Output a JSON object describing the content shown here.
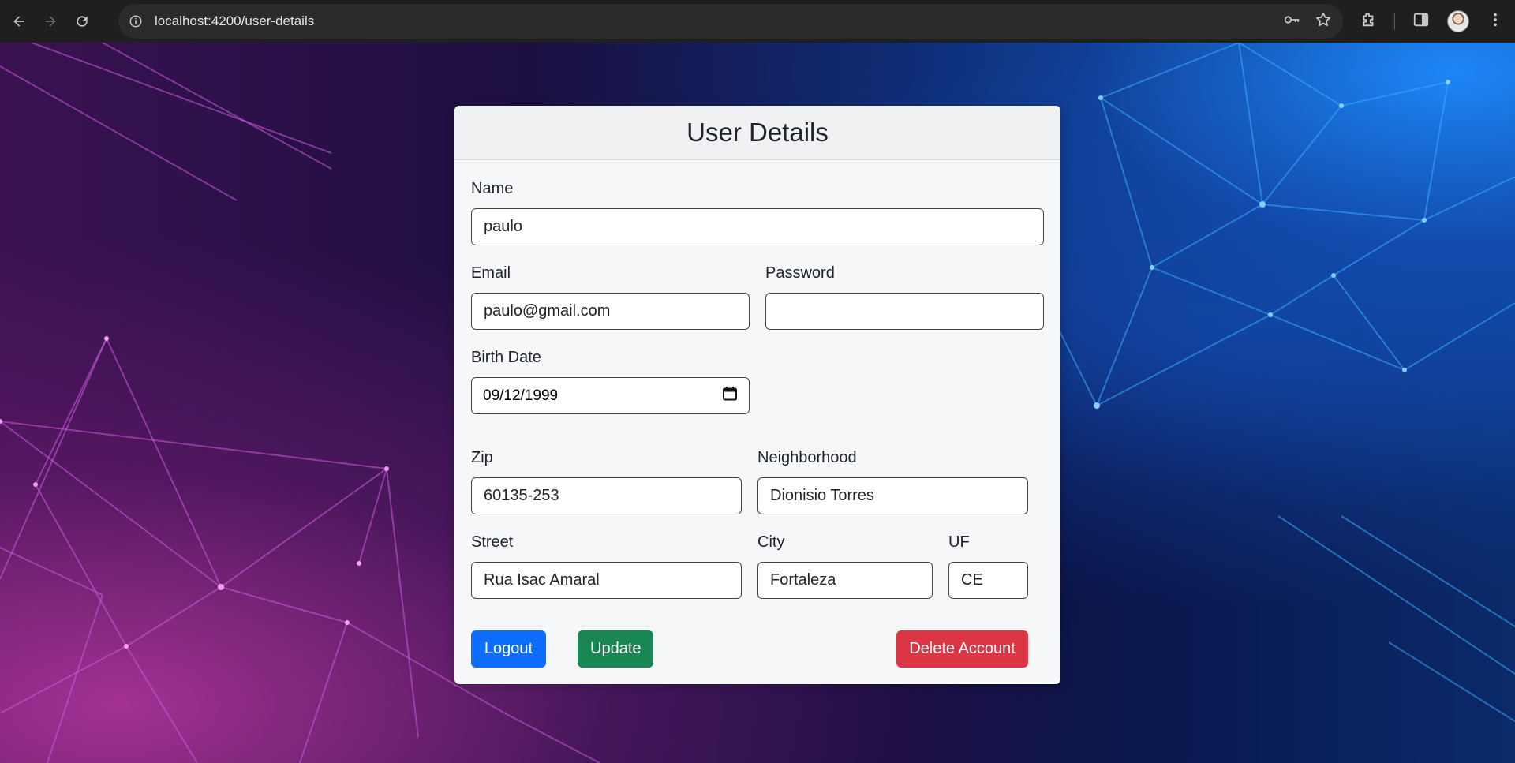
{
  "browser": {
    "url": "localhost:4200/user-details"
  },
  "card": {
    "title": "User Details"
  },
  "form": {
    "name": {
      "label": "Name",
      "value": "paulo"
    },
    "email": {
      "label": "Email",
      "value": "paulo@gmail.com"
    },
    "password": {
      "label": "Password",
      "value": ""
    },
    "birth_date": {
      "label": "Birth Date",
      "value": "09/12/1999"
    },
    "zip": {
      "label": "Zip",
      "value": "60135-253"
    },
    "neighborhood": {
      "label": "Neighborhood",
      "value": "Dionisio Torres"
    },
    "street": {
      "label": "Street",
      "value": "Rua Isac Amaral"
    },
    "city": {
      "label": "City",
      "value": "Fortaleza"
    },
    "uf": {
      "label": "UF",
      "value": "CE"
    }
  },
  "buttons": {
    "logout": "Logout",
    "update": "Update",
    "delete": "Delete Account"
  },
  "colors": {
    "primary": "#0d6efd",
    "success": "#198754",
    "danger": "#dc3545"
  }
}
